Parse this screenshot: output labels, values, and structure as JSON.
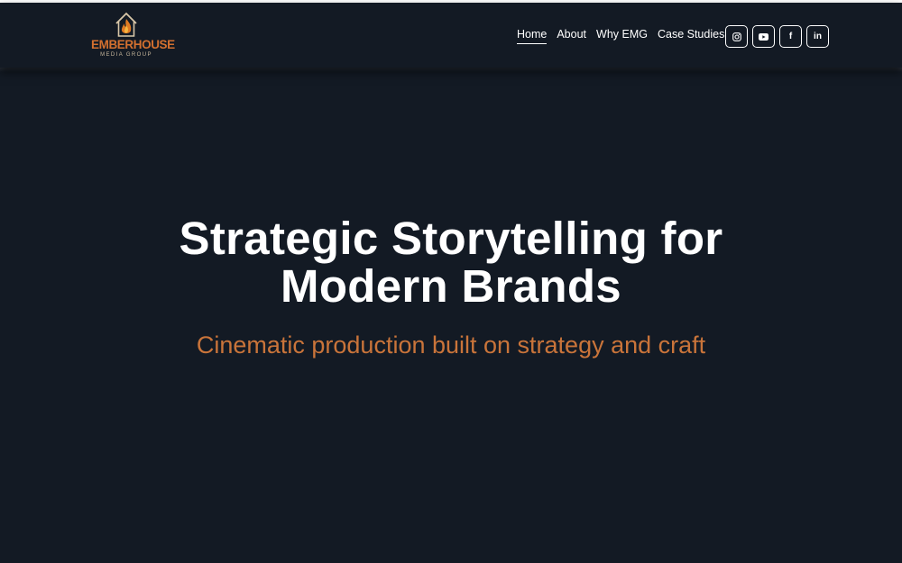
{
  "brand": {
    "name": "EMBERHOUSE",
    "tagline": "MEDIA GROUP",
    "accent": "#d3702f",
    "icon": "house-flame-icon"
  },
  "nav": {
    "items": [
      {
        "label": "Home",
        "active": true
      },
      {
        "label": "About",
        "active": false
      },
      {
        "label": "Why EMG",
        "active": false
      },
      {
        "label": "Case Studies",
        "active": false
      }
    ]
  },
  "socials": [
    {
      "icon": "instagram-icon"
    },
    {
      "icon": "youtube-icon"
    },
    {
      "icon": "facebook-icon",
      "glyph": "f"
    },
    {
      "icon": "linkedin-icon",
      "glyph": "in"
    }
  ],
  "hero": {
    "title_line1": "Strategic Storytelling for",
    "title_line2": "Modern Brands",
    "subtitle": "Cinematic production built on strategy and craft",
    "subtitle_color": "#c9743a"
  },
  "colors": {
    "background": "#131a24",
    "text": "#ffffff"
  }
}
